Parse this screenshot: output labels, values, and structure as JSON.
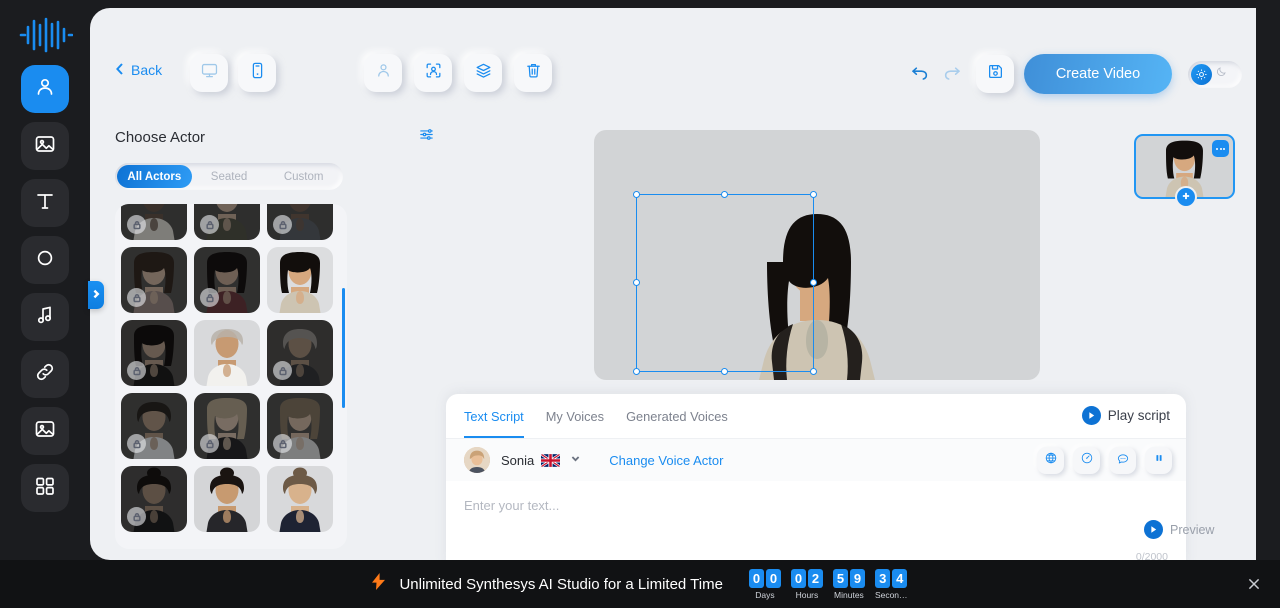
{
  "brand": {
    "logo_name": "synthesys-waveform-logo",
    "accent": "#1a8cf0",
    "rail_bg": "#1b1c1f",
    "app_bg": "#eef0f3"
  },
  "left_rail": {
    "items": [
      {
        "icon": "person-icon",
        "name": "avatar",
        "active": true
      },
      {
        "icon": "image-icon",
        "name": "background",
        "active": false
      },
      {
        "icon": "text-icon",
        "name": "text",
        "active": false
      },
      {
        "icon": "shape-icon",
        "name": "shapes",
        "active": false
      },
      {
        "icon": "music-icon",
        "name": "audio",
        "active": false
      },
      {
        "icon": "link-icon",
        "name": "link",
        "active": false
      },
      {
        "icon": "image-icon",
        "name": "media",
        "active": false
      },
      {
        "icon": "grid-icon",
        "name": "templates",
        "active": false
      }
    ]
  },
  "topbar": {
    "back_label": "Back",
    "devices": [
      {
        "name": "desktop-view",
        "icon": "monitor-icon",
        "active": false
      },
      {
        "name": "mobile-view",
        "icon": "mobile-icon",
        "active": true
      }
    ],
    "tools": [
      {
        "name": "actor-tool",
        "icon": "person-icon",
        "active": false
      },
      {
        "name": "face-crop-tool",
        "icon": "face-frame-icon",
        "active": true
      },
      {
        "name": "layers-tool",
        "icon": "layers-icon",
        "active": true
      },
      {
        "name": "delete-tool",
        "icon": "trash-icon",
        "active": true
      }
    ],
    "undo_label": "undo-icon",
    "redo_label": "redo-icon",
    "save_label": "save-icon",
    "create_video_label": "Create Video",
    "theme": {
      "light_icon": "sun-icon",
      "dark_icon": "moon-icon",
      "active": "light"
    }
  },
  "actor_panel": {
    "title": "Choose Actor",
    "filter_icon": "sliders-icon",
    "tabs": [
      {
        "label": "All Actors",
        "active": true
      },
      {
        "label": "Seated",
        "active": false
      },
      {
        "label": "Custom",
        "active": false
      }
    ],
    "actors": [
      {
        "id": 1,
        "locked": true,
        "bg": "#4b4a48",
        "skin": "#6b4a36",
        "shirt": "#cfc9bd",
        "hair": "#15110e",
        "hairstyle": "short",
        "selected": false
      },
      {
        "id": 2,
        "locked": true,
        "bg": "#4b4a48",
        "skin": "#c89a74",
        "shirt": "#4c4f35",
        "hair": "#3a2a1c",
        "hairstyle": "short",
        "selected": false
      },
      {
        "id": 3,
        "locked": true,
        "bg": "#4b4a48",
        "skin": "#7a5238",
        "shirt": "#4d5a66",
        "hair": "#17120f",
        "hairstyle": "short",
        "selected": false
      },
      {
        "id": 4,
        "locked": true,
        "bg": "#4e4d4b",
        "skin": "#d3a179",
        "shirt": "#9a7b74",
        "hair": "#3b2418",
        "hairstyle": "long",
        "selected": false
      },
      {
        "id": 5,
        "locked": true,
        "bg": "#4e4d4b",
        "skin": "#c9956d",
        "shirt": "#8d2a32",
        "hair": "#171210",
        "hairstyle": "long",
        "selected": false
      },
      {
        "id": 6,
        "locked": false,
        "bg": "#dcdddf",
        "skin": "#d6a87f",
        "shirt": "#cdc4b2",
        "hair": "#120e0c",
        "hairstyle": "long",
        "selected": true
      },
      {
        "id": 7,
        "locked": true,
        "bg": "#4a4946",
        "skin": "#b98c66",
        "shirt": "#1d1b1a",
        "hair": "#15100e",
        "hairstyle": "long",
        "selected": false
      },
      {
        "id": 8,
        "locked": false,
        "bg": "#d8d9db",
        "skin": "#c79a72",
        "shirt": "#f2f1ee",
        "hair": "#b9b2a9",
        "hairstyle": "bald",
        "selected": false
      },
      {
        "id": 9,
        "locked": true,
        "bg": "#4a4946",
        "skin": "#a97e57",
        "shirt": "#30343c",
        "hair": "#8d867e",
        "hairstyle": "short",
        "selected": false
      },
      {
        "id": 10,
        "locked": true,
        "bg": "#4c4b49",
        "skin": "#b4835c",
        "shirt": "#ced3da",
        "hair": "#2b231d",
        "hairstyle": "short",
        "selected": false
      },
      {
        "id": 11,
        "locked": true,
        "bg": "#4c4b49",
        "skin": "#d6ab85",
        "shirt": "#23262c",
        "hair": "#b39766",
        "hairstyle": "long",
        "selected": false
      },
      {
        "id": 12,
        "locked": true,
        "bg": "#4c4b49",
        "skin": "#d2a47c",
        "shirt": "#c9cbcd",
        "hair": "#8a6b45",
        "hairstyle": "long",
        "selected": false
      },
      {
        "id": 13,
        "locked": true,
        "bg": "#4a4947",
        "skin": "#a97c55",
        "shirt": "#1b1d21",
        "hair": "#191310",
        "hairstyle": "bun",
        "selected": false
      },
      {
        "id": 14,
        "locked": false,
        "bg": "#d4d5d7",
        "skin": "#c79a70",
        "shirt": "#26262a",
        "hair": "#1a1411",
        "hairstyle": "bun",
        "selected": false
      },
      {
        "id": 15,
        "locked": false,
        "bg": "#d8d9db",
        "skin": "#d8b28c",
        "shirt": "#1e2333",
        "hair": "#6d5a46",
        "hairstyle": "bun",
        "selected": false
      }
    ]
  },
  "canvas": {
    "selected_layer": "actor-layer",
    "handle_count": 8
  },
  "script_panel": {
    "tabs": [
      {
        "label": "Text Script",
        "active": true
      },
      {
        "label": "My Voices",
        "active": false
      },
      {
        "label": "Generated Voices",
        "active": false
      }
    ],
    "play_script_label": "Play script",
    "voice_name": "Sonia",
    "voice_flag": "uk-flag-icon",
    "change_voice_label": "Change Voice Actor",
    "tools": [
      {
        "name": "language-button",
        "icon": "globe-icon"
      },
      {
        "name": "speed-button",
        "icon": "gauge-icon"
      },
      {
        "name": "pronunciation-button",
        "icon": "speech-bubble-icon"
      },
      {
        "name": "pause-button",
        "icon": "pause-icon"
      }
    ],
    "placeholder": "Enter your text...",
    "char_count": "0/2000"
  },
  "right_panel": {
    "scene_menu_icon": "more-dots-icon",
    "add_scene_icon": "plus-icon",
    "preview_label": "Preview"
  },
  "banner": {
    "bolt_icon": "bolt-icon",
    "text": "Unlimited Synthesys AI Studio for a Limited Time",
    "countdown": [
      {
        "label": "Days",
        "digits": [
          "0",
          "0"
        ]
      },
      {
        "label": "Hours",
        "digits": [
          "0",
          "2"
        ]
      },
      {
        "label": "Minutes",
        "digits": [
          "5",
          "9"
        ]
      },
      {
        "label": "Secon…",
        "digits": [
          "3",
          "4"
        ]
      }
    ],
    "close_icon": "close-icon"
  }
}
